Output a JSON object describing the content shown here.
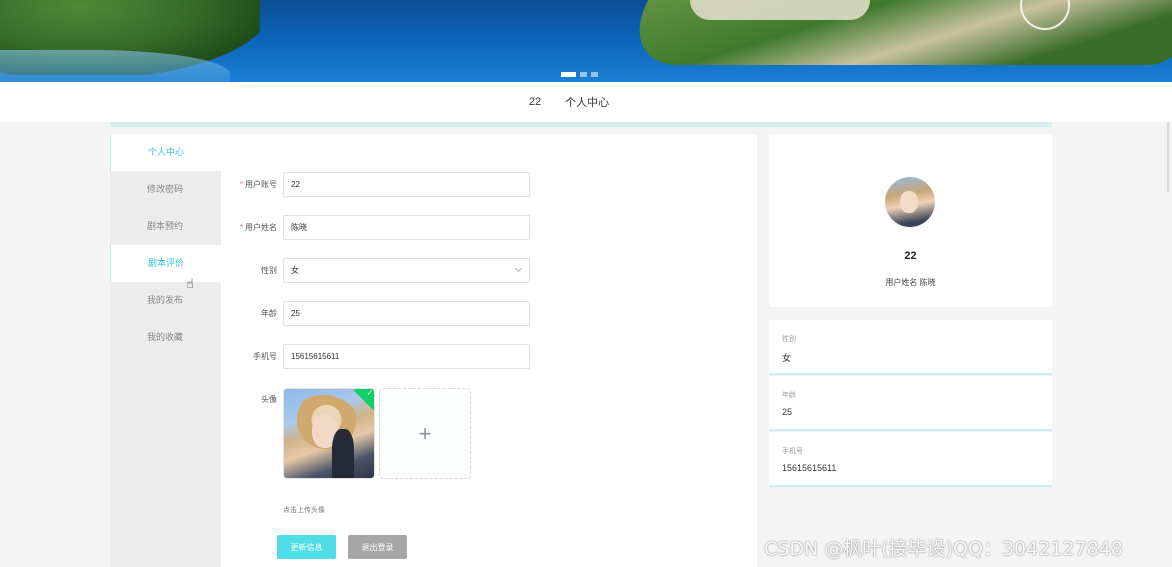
{
  "banner": {
    "slide_count": 3,
    "active_slide": 1
  },
  "topnav": {
    "items": [
      "22",
      "个人中心"
    ]
  },
  "sidebar": {
    "items": [
      {
        "label": "个人中心",
        "active": true
      },
      {
        "label": "修改密码",
        "active": false
      },
      {
        "label": "剧本预约",
        "active": false
      },
      {
        "label": "剧本评价",
        "active": false
      },
      {
        "label": "我的发布",
        "active": false
      },
      {
        "label": "我的收藏",
        "active": false
      }
    ]
  },
  "form": {
    "account_label": "用户账号",
    "account_value": "22",
    "name_label": "用户姓名",
    "name_value": "陈晓",
    "gender_label": "性别",
    "gender_value": "女",
    "age_label": "年龄",
    "age_value": "25",
    "phone_label": "手机号",
    "phone_value": "15615615611",
    "avatar_label": "头像",
    "upload_plus": "+",
    "upload_hint": "点击上传头像",
    "update_button": "更新信息",
    "logout_button": "退出登录"
  },
  "profile": {
    "username": "22",
    "name_line": "用户姓名 陈晓",
    "gender_label": "性别",
    "gender_value": "女",
    "age_label": "年龄",
    "age_value": "25",
    "phone_label": "手机号",
    "phone_value": "15615615611"
  },
  "colors": {
    "accent": "#4fdde6",
    "active_text": "#2cc7d4",
    "required": "#f56c6c",
    "success": "#13ce66"
  },
  "watermark": "CSDN @枫叶(接毕设)QQ：3042127848"
}
